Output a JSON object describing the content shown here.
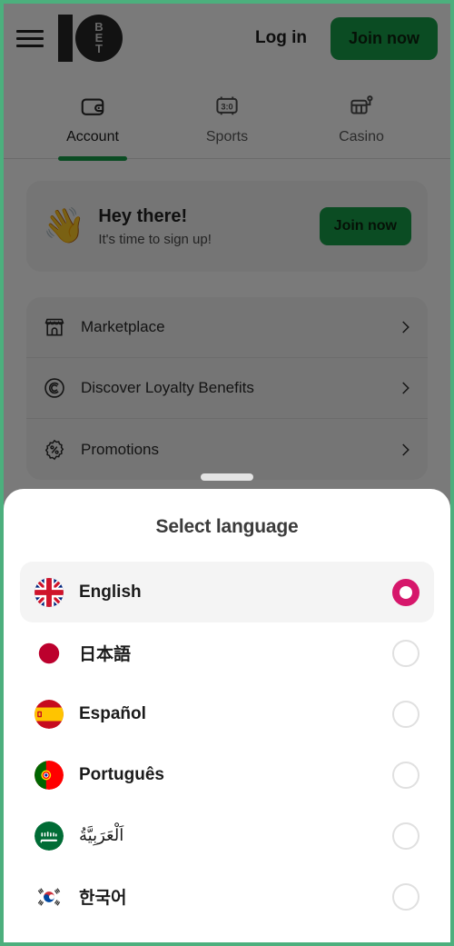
{
  "brand": {
    "logo_text": "10BET",
    "logo_letters": [
      "B",
      "E",
      "T"
    ],
    "green": "#17a04a",
    "accent_pink": "#d6176b"
  },
  "header": {
    "menu_icon": "hamburger-menu-icon",
    "login_label": "Log in",
    "join_label": "Join now"
  },
  "tabs": [
    {
      "label": "Account",
      "icon": "wallet-icon",
      "active": true
    },
    {
      "label": "Sports",
      "icon": "scoreboard-icon",
      "active": false
    },
    {
      "label": "Casino",
      "icon": "slot-machine-icon",
      "active": false
    }
  ],
  "greeting": {
    "emoji": "waving-hand-emoji",
    "title": "Hey there!",
    "subtitle": "It's time to sign up!",
    "button_label": "Join now"
  },
  "menu": {
    "items": [
      {
        "label": "Marketplace",
        "icon": "storefront-icon",
        "chevron": "chevron-right-icon"
      },
      {
        "label": "Discover Loyalty Benefits",
        "icon": "loyalty-c-icon",
        "chevron": "chevron-right-icon"
      },
      {
        "label": "Promotions",
        "icon": "percent-badge-icon",
        "chevron": "chevron-right-icon"
      }
    ]
  },
  "sheet": {
    "handle": "drag-handle",
    "title": "Select language",
    "languages": [
      {
        "label": "English",
        "flag": "flag-uk",
        "selected": true
      },
      {
        "label": "日本語",
        "flag": "flag-japan",
        "selected": false
      },
      {
        "label": "Español",
        "flag": "flag-spain",
        "selected": false
      },
      {
        "label": "Português",
        "flag": "flag-portugal",
        "selected": false
      },
      {
        "label": "اَلْعَرَبِيَّةُ",
        "flag": "flag-saudi-arabia",
        "selected": false
      },
      {
        "label": "한국어",
        "flag": "flag-south-korea",
        "selected": false
      }
    ]
  }
}
